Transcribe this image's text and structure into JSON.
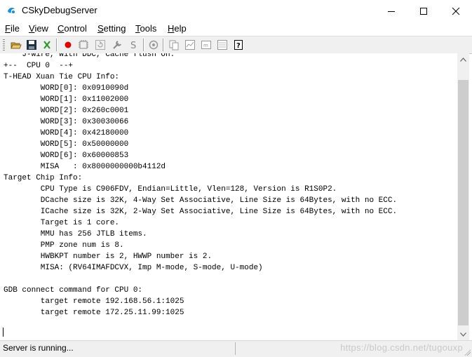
{
  "window": {
    "title": "CSkyDebugServer",
    "controls": {
      "minimize": "minimize",
      "maximize": "maximize",
      "close": "close"
    }
  },
  "menu": [
    {
      "label": "File",
      "mnemonic": "F",
      "rest": "ile"
    },
    {
      "label": "View",
      "mnemonic": "V",
      "rest": "iew"
    },
    {
      "label": "Control",
      "mnemonic": "C",
      "rest": "ontrol"
    },
    {
      "label": "Setting",
      "mnemonic": "S",
      "rest": "etting"
    },
    {
      "label": "Tools",
      "mnemonic": "T",
      "rest": "ools"
    },
    {
      "label": "Help",
      "mnemonic": "H",
      "rest": "elp"
    }
  ],
  "toolbar": {
    "buttons": [
      {
        "name": "open-icon"
      },
      {
        "name": "save-icon"
      },
      {
        "name": "disconnect-icon"
      },
      {
        "name": "record-icon",
        "color": "#e00000"
      },
      {
        "name": "device-icon"
      },
      {
        "name": "refresh-icon"
      },
      {
        "name": "settings-wrench-icon"
      },
      {
        "name": "script-icon"
      },
      {
        "name": "help-circle-icon"
      },
      {
        "name": "copy-icon"
      },
      {
        "name": "chart-icon"
      },
      {
        "name": "memory-icon"
      },
      {
        "name": "dump-icon"
      },
      {
        "name": "about-icon"
      }
    ]
  },
  "console": {
    "lines": [
      "    J-wire, with DDC, Cache flush On.",
      "+--  CPU 0  --+",
      "T-HEAD Xuan Tie CPU Info:",
      "        WORD[0]: 0x0910090d",
      "        WORD[1]: 0x11002000",
      "        WORD[2]: 0x260c0001",
      "        WORD[3]: 0x30030066",
      "        WORD[4]: 0x42180000",
      "        WORD[5]: 0x50000000",
      "        WORD[6]: 0x60000853",
      "        MISA   : 0x8000000000b4112d",
      "Target Chip Info:",
      "        CPU Type is C906FDV, Endian=Little, Vlen=128, Version is R1S0P2.",
      "        DCache size is 32K, 4-Way Set Associative, Line Size is 64Bytes, with no ECC.",
      "        ICache size is 32K, 2-Way Set Associative, Line Size is 64Bytes, with no ECC.",
      "        Target is 1 core.",
      "        MMU has 256 JTLB items.",
      "        PMP zone num is 8.",
      "        HWBKPT number is 2, HWWP number is 2.",
      "        MISA: (RV64IMAFDCVX, Imp M-mode, S-mode, U-mode)",
      "",
      "GDB connect command for CPU 0:",
      "        target remote 192.168.56.1:1025",
      "        target remote 172.25.11.99:1025"
    ]
  },
  "status": {
    "text": "Server is running...",
    "watermark": "https://blog.csdn.net/tugouxp"
  },
  "colors": {
    "record": "#e00000",
    "chrome": "#f0f0f0",
    "thumb": "#cdcdcd"
  }
}
